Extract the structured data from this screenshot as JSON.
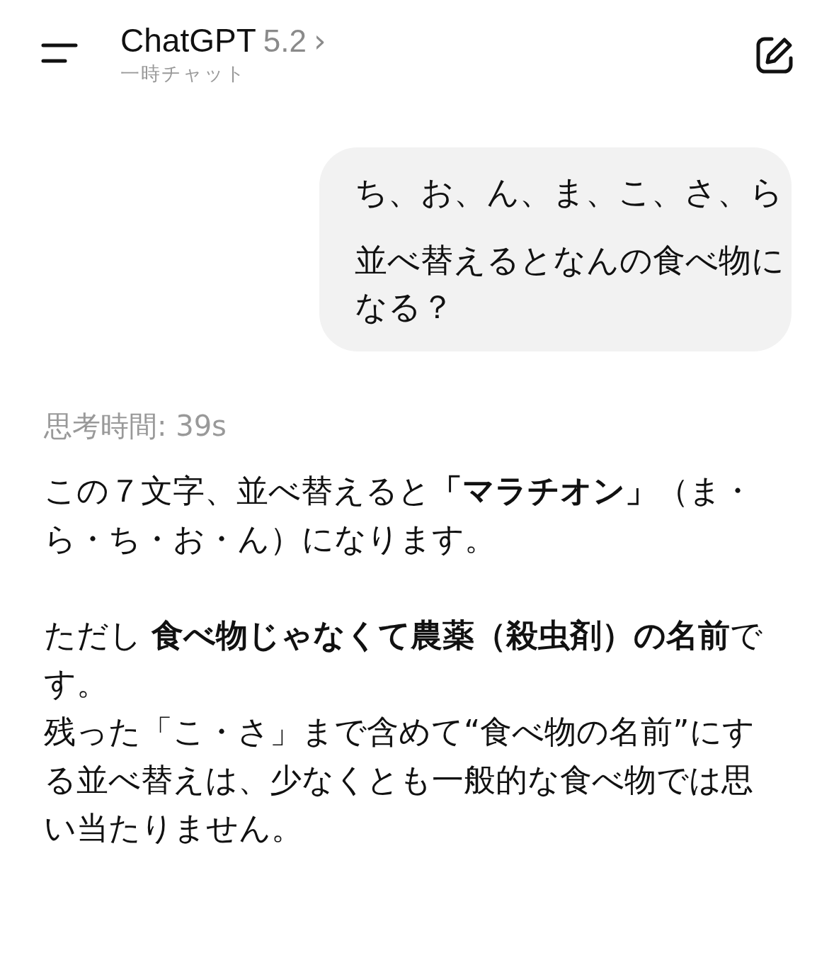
{
  "header": {
    "title": "ChatGPT",
    "version": "5.2",
    "chevron": "›",
    "subtitle": "一時チャット"
  },
  "user_message": {
    "paragraphs": [
      "ち、お、ん、ま、こ、さ、ら",
      "並べ替えるとなんの食べ物になる？"
    ]
  },
  "thinking": "思考時間: 39s",
  "response": {
    "paragraphs": [
      {
        "lines": [
          "この７文字、並べ替えると**「マラチオン」**（ま・ら・ち・お・ん）になります。"
        ]
      },
      {
        "lines": [
          "ただし **食べ物じゃなくて農薬（殺虫剤）の名前**です。",
          "残った「こ・さ」まで含めて“食べ物の名前”にする並べ替えは、少なくとも一般的な食べ物では思い当たりません。"
        ]
      }
    ]
  }
}
